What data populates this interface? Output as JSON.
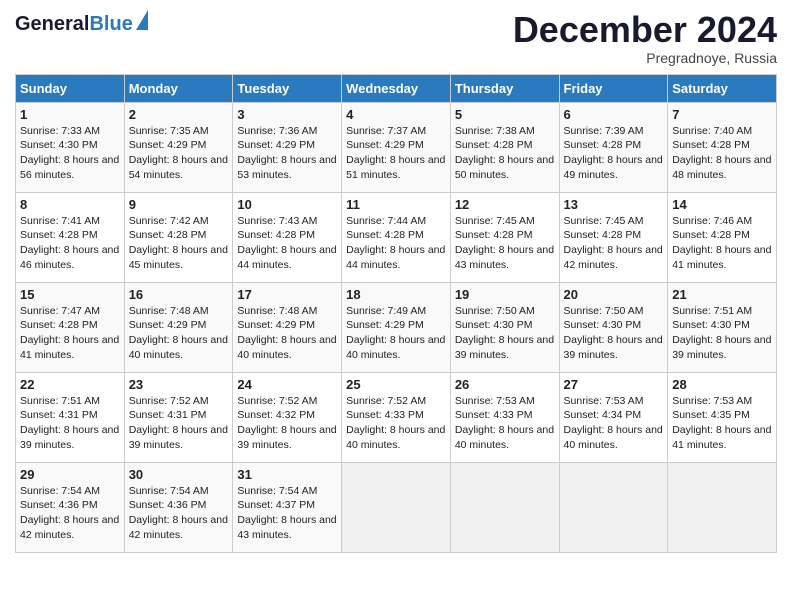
{
  "header": {
    "logo_general": "General",
    "logo_blue": "Blue",
    "month_title": "December 2024",
    "location": "Pregradnoye, Russia"
  },
  "days_of_week": [
    "Sunday",
    "Monday",
    "Tuesday",
    "Wednesday",
    "Thursday",
    "Friday",
    "Saturday"
  ],
  "weeks": [
    [
      {
        "day": "1",
        "sunrise": "Sunrise: 7:33 AM",
        "sunset": "Sunset: 4:30 PM",
        "daylight": "Daylight: 8 hours and 56 minutes."
      },
      {
        "day": "2",
        "sunrise": "Sunrise: 7:35 AM",
        "sunset": "Sunset: 4:29 PM",
        "daylight": "Daylight: 8 hours and 54 minutes."
      },
      {
        "day": "3",
        "sunrise": "Sunrise: 7:36 AM",
        "sunset": "Sunset: 4:29 PM",
        "daylight": "Daylight: 8 hours and 53 minutes."
      },
      {
        "day": "4",
        "sunrise": "Sunrise: 7:37 AM",
        "sunset": "Sunset: 4:29 PM",
        "daylight": "Daylight: 8 hours and 51 minutes."
      },
      {
        "day": "5",
        "sunrise": "Sunrise: 7:38 AM",
        "sunset": "Sunset: 4:28 PM",
        "daylight": "Daylight: 8 hours and 50 minutes."
      },
      {
        "day": "6",
        "sunrise": "Sunrise: 7:39 AM",
        "sunset": "Sunset: 4:28 PM",
        "daylight": "Daylight: 8 hours and 49 minutes."
      },
      {
        "day": "7",
        "sunrise": "Sunrise: 7:40 AM",
        "sunset": "Sunset: 4:28 PM",
        "daylight": "Daylight: 8 hours and 48 minutes."
      }
    ],
    [
      {
        "day": "8",
        "sunrise": "Sunrise: 7:41 AM",
        "sunset": "Sunset: 4:28 PM",
        "daylight": "Daylight: 8 hours and 46 minutes."
      },
      {
        "day": "9",
        "sunrise": "Sunrise: 7:42 AM",
        "sunset": "Sunset: 4:28 PM",
        "daylight": "Daylight: 8 hours and 45 minutes."
      },
      {
        "day": "10",
        "sunrise": "Sunrise: 7:43 AM",
        "sunset": "Sunset: 4:28 PM",
        "daylight": "Daylight: 8 hours and 44 minutes."
      },
      {
        "day": "11",
        "sunrise": "Sunrise: 7:44 AM",
        "sunset": "Sunset: 4:28 PM",
        "daylight": "Daylight: 8 hours and 44 minutes."
      },
      {
        "day": "12",
        "sunrise": "Sunrise: 7:45 AM",
        "sunset": "Sunset: 4:28 PM",
        "daylight": "Daylight: 8 hours and 43 minutes."
      },
      {
        "day": "13",
        "sunrise": "Sunrise: 7:45 AM",
        "sunset": "Sunset: 4:28 PM",
        "daylight": "Daylight: 8 hours and 42 minutes."
      },
      {
        "day": "14",
        "sunrise": "Sunrise: 7:46 AM",
        "sunset": "Sunset: 4:28 PM",
        "daylight": "Daylight: 8 hours and 41 minutes."
      }
    ],
    [
      {
        "day": "15",
        "sunrise": "Sunrise: 7:47 AM",
        "sunset": "Sunset: 4:28 PM",
        "daylight": "Daylight: 8 hours and 41 minutes."
      },
      {
        "day": "16",
        "sunrise": "Sunrise: 7:48 AM",
        "sunset": "Sunset: 4:29 PM",
        "daylight": "Daylight: 8 hours and 40 minutes."
      },
      {
        "day": "17",
        "sunrise": "Sunrise: 7:48 AM",
        "sunset": "Sunset: 4:29 PM",
        "daylight": "Daylight: 8 hours and 40 minutes."
      },
      {
        "day": "18",
        "sunrise": "Sunrise: 7:49 AM",
        "sunset": "Sunset: 4:29 PM",
        "daylight": "Daylight: 8 hours and 40 minutes."
      },
      {
        "day": "19",
        "sunrise": "Sunrise: 7:50 AM",
        "sunset": "Sunset: 4:30 PM",
        "daylight": "Daylight: 8 hours and 39 minutes."
      },
      {
        "day": "20",
        "sunrise": "Sunrise: 7:50 AM",
        "sunset": "Sunset: 4:30 PM",
        "daylight": "Daylight: 8 hours and 39 minutes."
      },
      {
        "day": "21",
        "sunrise": "Sunrise: 7:51 AM",
        "sunset": "Sunset: 4:30 PM",
        "daylight": "Daylight: 8 hours and 39 minutes."
      }
    ],
    [
      {
        "day": "22",
        "sunrise": "Sunrise: 7:51 AM",
        "sunset": "Sunset: 4:31 PM",
        "daylight": "Daylight: 8 hours and 39 minutes."
      },
      {
        "day": "23",
        "sunrise": "Sunrise: 7:52 AM",
        "sunset": "Sunset: 4:31 PM",
        "daylight": "Daylight: 8 hours and 39 minutes."
      },
      {
        "day": "24",
        "sunrise": "Sunrise: 7:52 AM",
        "sunset": "Sunset: 4:32 PM",
        "daylight": "Daylight: 8 hours and 39 minutes."
      },
      {
        "day": "25",
        "sunrise": "Sunrise: 7:52 AM",
        "sunset": "Sunset: 4:33 PM",
        "daylight": "Daylight: 8 hours and 40 minutes."
      },
      {
        "day": "26",
        "sunrise": "Sunrise: 7:53 AM",
        "sunset": "Sunset: 4:33 PM",
        "daylight": "Daylight: 8 hours and 40 minutes."
      },
      {
        "day": "27",
        "sunrise": "Sunrise: 7:53 AM",
        "sunset": "Sunset: 4:34 PM",
        "daylight": "Daylight: 8 hours and 40 minutes."
      },
      {
        "day": "28",
        "sunrise": "Sunrise: 7:53 AM",
        "sunset": "Sunset: 4:35 PM",
        "daylight": "Daylight: 8 hours and 41 minutes."
      }
    ],
    [
      {
        "day": "29",
        "sunrise": "Sunrise: 7:54 AM",
        "sunset": "Sunset: 4:36 PM",
        "daylight": "Daylight: 8 hours and 42 minutes."
      },
      {
        "day": "30",
        "sunrise": "Sunrise: 7:54 AM",
        "sunset": "Sunset: 4:36 PM",
        "daylight": "Daylight: 8 hours and 42 minutes."
      },
      {
        "day": "31",
        "sunrise": "Sunrise: 7:54 AM",
        "sunset": "Sunset: 4:37 PM",
        "daylight": "Daylight: 8 hours and 43 minutes."
      },
      null,
      null,
      null,
      null
    ]
  ]
}
